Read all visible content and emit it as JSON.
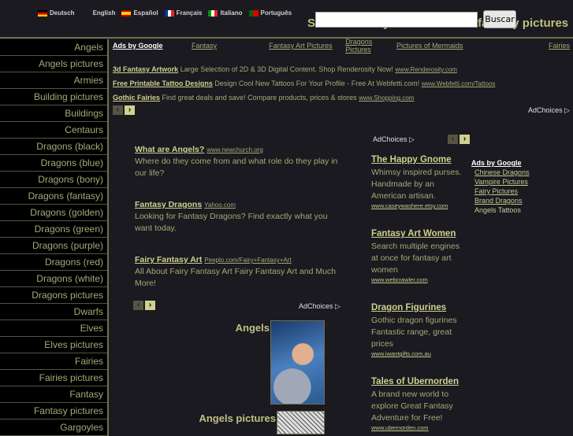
{
  "header": {
    "title": "Sam's Fantasy: Thousands of fantasy pictures",
    "search_placeholder": "",
    "search_button": "Buscar",
    "languages": [
      {
        "label": "Deutsch",
        "icon": "flag-de-icon"
      },
      {
        "label": "English",
        "icon": "flag-uk-icon"
      },
      {
        "label": "Español",
        "icon": "flag-es-icon"
      },
      {
        "label": "Français",
        "icon": "flag-fr-icon"
      },
      {
        "label": "Italiano",
        "icon": "flag-it-icon"
      },
      {
        "label": "Português",
        "icon": "flag-pt-icon"
      }
    ]
  },
  "sidebar": {
    "items": [
      "Angels",
      "Angels pictures",
      "Armies",
      "Building pictures",
      "Buildings",
      "Centaurs",
      "Dragons (black)",
      "Dragons (blue)",
      "Dragons (bony)",
      "Dragons (fantasy)",
      "Dragons (golden)",
      "Dragons (green)",
      "Dragons (purple)",
      "Dragons (red)",
      "Dragons (white)",
      "Dragons pictures",
      "Dwarfs",
      "Elves",
      "Elves pictures",
      "Fairies",
      "Fairies pictures",
      "Fantasy",
      "Fantasy pictures",
      "Gargoyles"
    ]
  },
  "top_ads": {
    "ads_by_google": "Ads by Google",
    "links": [
      "Fantasy",
      "Fantasy Art Pictures",
      "Dragons Pictures",
      "Pictures of Mermaids",
      "Fairies"
    ],
    "ads": [
      {
        "title": "3d Fantasy Artwork",
        "text": "Large Selection of 2D & 3D Digital Content. Shop Renderosity Now!",
        "url": "www.Renderosity.com"
      },
      {
        "title": "Free Printable Tattoo Designs",
        "text": "Design Cool New Tattoos For Your Profile - Free At Webfetti.com!",
        "url": "www.Webfetti.com/Tattoos"
      },
      {
        "title": "Gothic Fairies",
        "text": "Find great deals and save! Compare products, prices & stores",
        "url": "www.Shopping.com"
      }
    ],
    "adchoices": "AdChoices ▷"
  },
  "mid_ads": {
    "adchoices": "AdChoices ▷",
    "ads": [
      {
        "title": "What are Angels?",
        "url": "www.newchurch.org",
        "text": "Where do they come from and what role do they play in our life?"
      },
      {
        "title": "Fantasy Dragons",
        "url": "Yahoo.com",
        "text": "Looking for Fantasy Dragons? Find exactly what you want today."
      },
      {
        "title": "Fairy Fantasy Art",
        "url": "Peeplo.com/Fairy+Fantasy+Art",
        "text": "All About Fairy Fantasy Art Fairy Fantasy Art and Much More!"
      }
    ]
  },
  "right_ads": {
    "adchoices": "AdChoices ▷",
    "ads": [
      {
        "title": "The Happy Gnome",
        "text": "Whimsy inspired purses. Handmade by an American artisan.",
        "url": "www.caseywashere.etsy.com"
      },
      {
        "title": "Fantasy Art Women",
        "text": "Search multiple engines at once for fantasy art women",
        "url": "www.webcrawler.com"
      },
      {
        "title": "Dragon Figurines",
        "text": "Gothic dragon figurines Fantastic range, great prices",
        "url": "www.iwantgifts.com.au"
      },
      {
        "title": "Tales of Ubernorden",
        "text": "A brand new world to explore Great Fantasy Adventure for Free!",
        "url": "www.ubernorden.com"
      }
    ]
  },
  "google_links": {
    "header": "Ads by Google",
    "links": [
      "Chinese Dragons",
      "Vampire Pictures",
      "Fairy Pictures",
      "Brand Dragons"
    ],
    "plain": "Angels Tattoos"
  },
  "gallery": [
    {
      "label": "Angels"
    },
    {
      "label": "Angels pictures"
    }
  ],
  "nav": {
    "prev": "‹",
    "next": "›"
  }
}
